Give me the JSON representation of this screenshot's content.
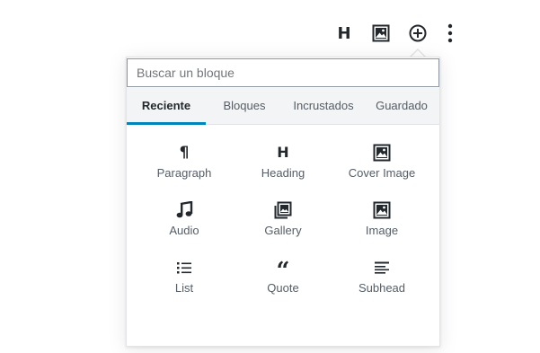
{
  "toolbar": {
    "items": [
      {
        "icon": "heading-icon",
        "glyph": "H"
      },
      {
        "icon": "image-icon"
      },
      {
        "icon": "add-block-icon"
      },
      {
        "icon": "more-options-icon"
      }
    ]
  },
  "inserter": {
    "search": {
      "placeholder": "Buscar un bloque",
      "value": ""
    },
    "tabs": [
      {
        "label": "Reciente",
        "active": true
      },
      {
        "label": "Bloques",
        "active": false
      },
      {
        "label": "Incrustados",
        "active": false
      },
      {
        "label": "Guardado",
        "active": false
      }
    ],
    "blocks": [
      {
        "label": "Paragraph",
        "icon": "paragraph-icon",
        "glyph": "¶"
      },
      {
        "label": "Heading",
        "icon": "heading-icon",
        "glyph": "H"
      },
      {
        "label": "Cover Image",
        "icon": "cover-image-icon"
      },
      {
        "label": "Audio",
        "icon": "audio-icon"
      },
      {
        "label": "Gallery",
        "icon": "gallery-icon"
      },
      {
        "label": "Image",
        "icon": "image-icon"
      },
      {
        "label": "List",
        "icon": "list-icon"
      },
      {
        "label": "Quote",
        "icon": "quote-icon",
        "glyph": "“"
      },
      {
        "label": "Subhead",
        "icon": "subhead-icon"
      }
    ]
  },
  "colors": {
    "accent": "#0085ba",
    "icon": "#23282d",
    "text": "#555d66",
    "tabs_bg": "#f3f4f5",
    "border": "#e2e4e7"
  }
}
